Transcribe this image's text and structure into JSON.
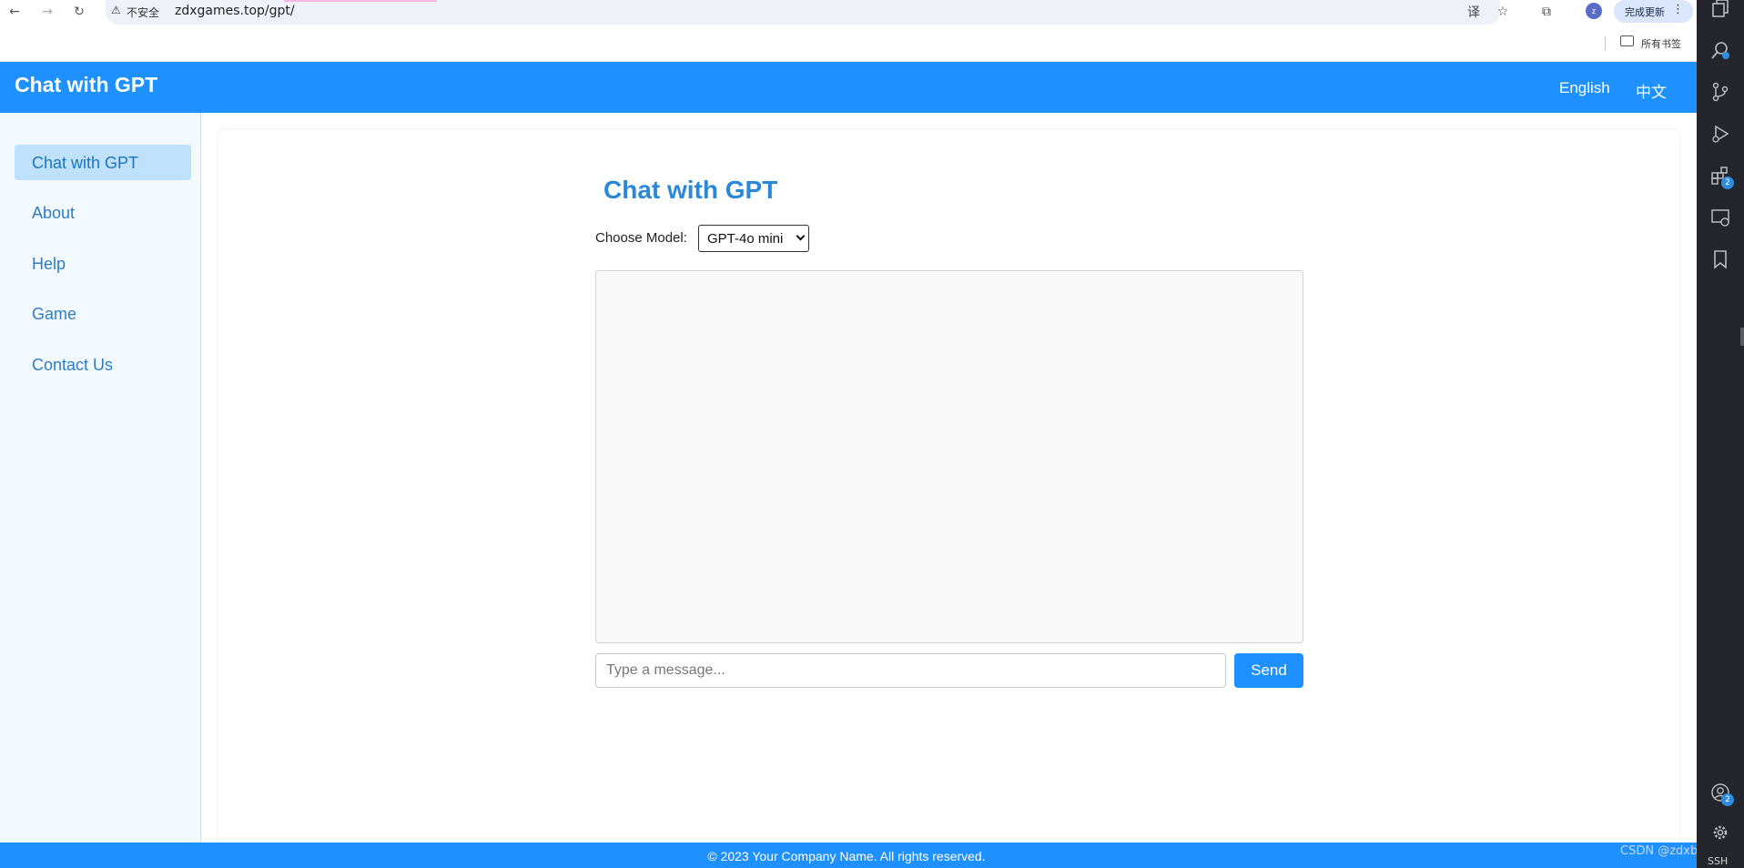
{
  "browser": {
    "nav": {
      "back": "←",
      "forward": "→",
      "reload": "↻"
    },
    "address_bar": {
      "warning_glyph": "⚠",
      "security_label": "不安全",
      "url": "zdxgames.top/gpt/"
    },
    "toolbar": {
      "translate": "译",
      "bookmark": "☆",
      "extensions": "⧉"
    },
    "profile_initial": "z",
    "update_button": "完成更新",
    "kebab": "⋮",
    "bookmarks_label": "所有书签"
  },
  "site": {
    "title": "Chat with GPT",
    "languages": [
      "English",
      "中文"
    ]
  },
  "sidebar": {
    "items": [
      {
        "label": "Chat with GPT",
        "active": true
      },
      {
        "label": "About"
      },
      {
        "label": "Help"
      },
      {
        "label": "Game"
      },
      {
        "label": "Contact Us"
      }
    ]
  },
  "chat": {
    "heading": "Chat with GPT",
    "model_label": "Choose Model:",
    "selected_model": "GPT-4o mini",
    "input_placeholder": "Type a message...",
    "send_label": "Send",
    "messages": []
  },
  "footer": {
    "text": "© 2023 Your Company Name. All rights reserved."
  },
  "editor_sidebar": {
    "icons": [
      "copy-icon",
      "search-icon",
      "source-control-icon",
      "run-debug-icon",
      "extensions-icon",
      "remote-explorer-icon",
      "bookmark-icon",
      "account-icon",
      "settings-icon"
    ],
    "badges": {
      "extensions": "2",
      "account": "2"
    },
    "remote_label": "SSH"
  },
  "watermark": "CSDN @zdxbigegg",
  "colors": {
    "brand_blue": "#1e90ff",
    "active_item_bg": "#bfe1fb",
    "sidebar_bg": "#f2f9ff"
  }
}
